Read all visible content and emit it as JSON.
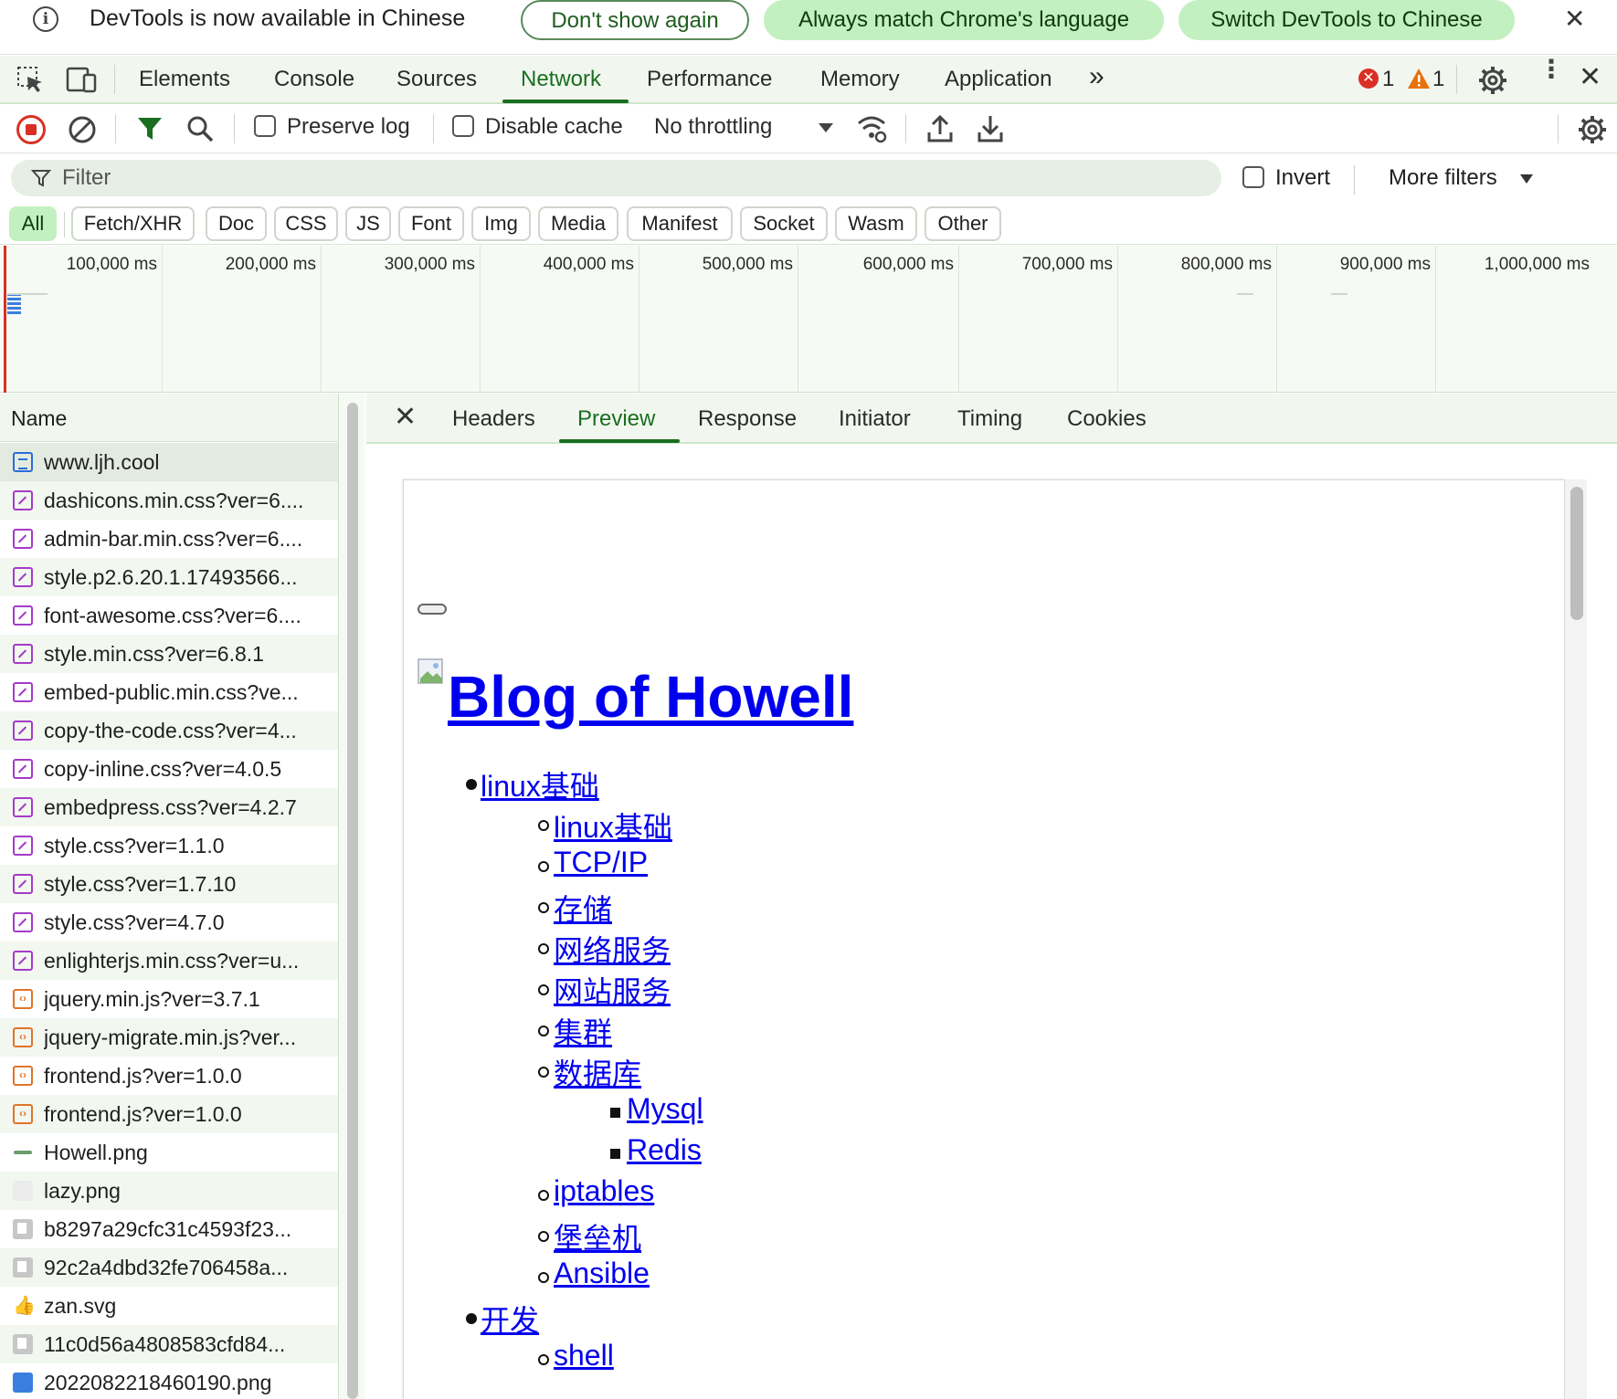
{
  "infobar": {
    "message": "DevTools is now available in Chinese",
    "btn_dont_show": "Don't show again",
    "btn_always_match": "Always match Chrome's language",
    "btn_switch": "Switch DevTools to Chinese"
  },
  "tabs": {
    "elements": "Elements",
    "console": "Console",
    "sources": "Sources",
    "network": "Network",
    "performance": "Performance",
    "memory": "Memory",
    "application": "Application",
    "more": "»",
    "error_count": "1",
    "warning_count": "1"
  },
  "toolbar": {
    "preserve_log": "Preserve log",
    "disable_cache": "Disable cache",
    "throttling": "No throttling"
  },
  "filter": {
    "placeholder": "Filter",
    "invert": "Invert",
    "more_filters": "More filters"
  },
  "chips": [
    "All",
    "Fetch/XHR",
    "Doc",
    "CSS",
    "JS",
    "Font",
    "Img",
    "Media",
    "Manifest",
    "Socket",
    "Wasm",
    "Other"
  ],
  "overview": {
    "labels": [
      "100,000 ms",
      "200,000 ms",
      "300,000 ms",
      "400,000 ms",
      "500,000 ms",
      "600,000 ms",
      "700,000 ms",
      "800,000 ms",
      "900,000 ms",
      "1,000,000 ms"
    ]
  },
  "requests": {
    "column_name": "Name",
    "items": [
      {
        "name": "www.ljh.cool",
        "type": "doc"
      },
      {
        "name": "dashicons.min.css?ver=6....",
        "type": "css"
      },
      {
        "name": "admin-bar.min.css?ver=6....",
        "type": "css"
      },
      {
        "name": "style.p2.6.20.1.17493566...",
        "type": "css"
      },
      {
        "name": "font-awesome.css?ver=6....",
        "type": "css"
      },
      {
        "name": "style.min.css?ver=6.8.1",
        "type": "css"
      },
      {
        "name": "embed-public.min.css?ve...",
        "type": "css"
      },
      {
        "name": "copy-the-code.css?ver=4...",
        "type": "css"
      },
      {
        "name": "copy-inline.css?ver=4.0.5",
        "type": "css"
      },
      {
        "name": "embedpress.css?ver=4.2.7",
        "type": "css"
      },
      {
        "name": "style.css?ver=1.1.0",
        "type": "css"
      },
      {
        "name": "style.css?ver=1.7.10",
        "type": "css"
      },
      {
        "name": "style.css?ver=4.7.0",
        "type": "css"
      },
      {
        "name": "enlighterjs.min.css?ver=u...",
        "type": "css"
      },
      {
        "name": "jquery.min.js?ver=3.7.1",
        "type": "js"
      },
      {
        "name": "jquery-migrate.min.js?ver...",
        "type": "js"
      },
      {
        "name": "frontend.js?ver=1.0.0",
        "type": "js"
      },
      {
        "name": "frontend.js?ver=1.0.0",
        "type": "js"
      },
      {
        "name": "Howell.png",
        "type": "green"
      },
      {
        "name": "lazy.png",
        "type": "blank"
      },
      {
        "name": "b8297a29cfc31c4593f23...",
        "type": "img"
      },
      {
        "name": "92c2a4dbd32fe706458a...",
        "type": "img"
      },
      {
        "name": "zan.svg",
        "type": "thumb"
      },
      {
        "name": "11c0d56a4808583cfd84...",
        "type": "img"
      },
      {
        "name": "2022082218460190.png",
        "type": "round"
      }
    ]
  },
  "details": {
    "tabs": [
      "Headers",
      "Preview",
      "Response",
      "Initiator",
      "Timing",
      "Cookies"
    ],
    "active_tab": "Preview"
  },
  "preview": {
    "title": "Blog of Howell",
    "links": [
      {
        "text": "linux基础",
        "level": 1
      },
      {
        "text": "linux基础",
        "level": 2
      },
      {
        "text": "TCP/IP",
        "level": 2
      },
      {
        "text": "存储",
        "level": 2
      },
      {
        "text": "网络服务",
        "level": 2
      },
      {
        "text": "网站服务",
        "level": 2
      },
      {
        "text": "集群",
        "level": 2
      },
      {
        "text": "数据库",
        "level": 2
      },
      {
        "text": "Mysql",
        "level": 3
      },
      {
        "text": "Redis",
        "level": 3
      },
      {
        "text": "iptables",
        "level": 2
      },
      {
        "text": "堡垒机",
        "level": 2
      },
      {
        "text": "Ansible",
        "level": 2
      },
      {
        "text": "开发",
        "level": 1
      },
      {
        "text": "shell",
        "level": 2
      }
    ]
  },
  "colors": {
    "accent": "#1a6e1f",
    "chip_active": "#c3f0c0",
    "link": "#0000ee",
    "record_red": "#d93025"
  }
}
